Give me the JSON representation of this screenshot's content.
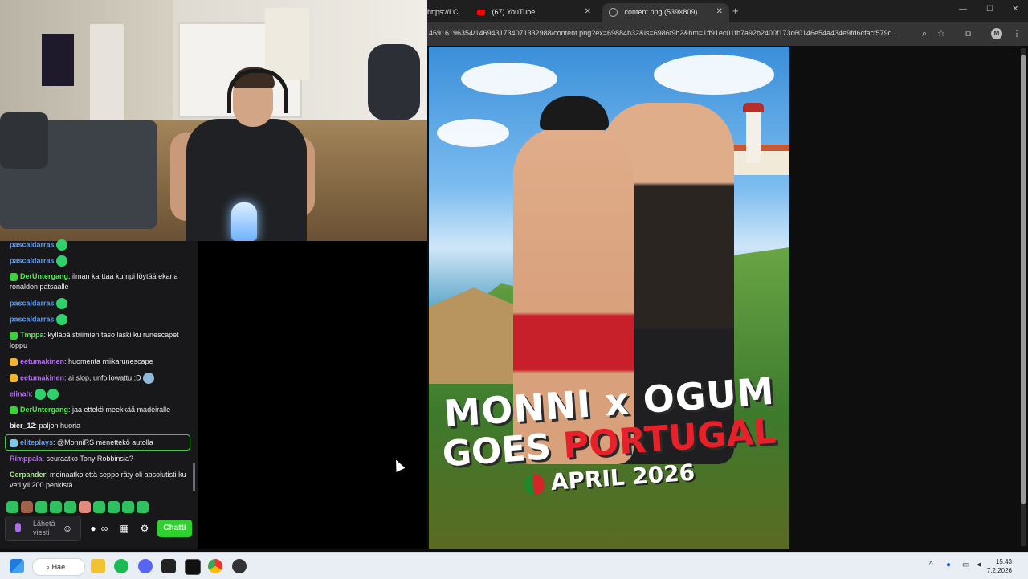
{
  "chat": {
    "messages": [
      {
        "user": "pascaldarras",
        "text": "",
        "user_color": "#5b9bf8"
      },
      {
        "user": "pascaldarras",
        "text": "",
        "user_color": "#5b9bf8"
      },
      {
        "user": "DerUntergang",
        "text": ": ilman karttaa kumpi löytää ekana ronaldon patsaalle",
        "user_color": "#55e655"
      },
      {
        "user": "pascaldarras",
        "text": "",
        "user_color": "#5b9bf8"
      },
      {
        "user": "pascaldarras",
        "text": "",
        "user_color": "#5b9bf8"
      },
      {
        "user": "Tmppa",
        "text": ": kylläpä striimien taso laski ku runescapet loppu",
        "user_color": "#55e655"
      },
      {
        "user": "eetumakinen",
        "text": ": huomenta miikarunescape",
        "user_color": "#b46cf0"
      },
      {
        "user": "eetumakinen",
        "text": ": ai slop, unfollowattu :D",
        "user_color": "#b46cf0"
      },
      {
        "user": "elinah",
        "text": ":",
        "user_color": "#b46cf0"
      },
      {
        "user": "DerUntergang",
        "text": ": jaa ettekö meekkää madeiralle",
        "user_color": "#55e655"
      },
      {
        "user": "bier_12",
        "text": ": paljon huoria",
        "user_color": "#efeff1"
      },
      {
        "user": "eliteplays",
        "text": ": @MonniRS menettekö autolla",
        "user_color": "#5b9bf8"
      },
      {
        "user": "Rimppala",
        "text": ": seuraatko Tony Robbinsia?",
        "user_color": "#b46cf0"
      },
      {
        "user": "Cerpander",
        "text": ": meinaatko että seppo räty oli absolutisti ku veti yli 200 penkistä",
        "user_color": "#9cf07a"
      }
    ],
    "input_placeholder": "Lähetä viesti",
    "send_label": "Chatti"
  },
  "browser": {
    "tabs": [
      {
        "title": "https://LC",
        "icon": "lock-icon"
      },
      {
        "title": "(67) YouTube",
        "icon": "youtube-icon"
      },
      {
        "title": "content.png (539×809)",
        "icon": "globe-icon"
      }
    ],
    "new_tab_symbol": "+",
    "url": "46916196354/1469431734071332988/content.png?ex=69884b32&is=6986f9b2&hm=1ff91ec01fb7a92b2400f173c60146e54a434e9fd6cfacf579d..."
  },
  "poster": {
    "line1": "MONNI x OGUM",
    "goes": "GOES",
    "portugal": "PORTUGAL",
    "date": "APRIL 2026"
  },
  "taskbar": {
    "search_label": "Hae",
    "time": "15.43",
    "date": "7.2.2026"
  },
  "colors": {
    "chat_bg": "#18181b",
    "send_button": "#2fd12f",
    "poster_red": "#e8202a"
  }
}
